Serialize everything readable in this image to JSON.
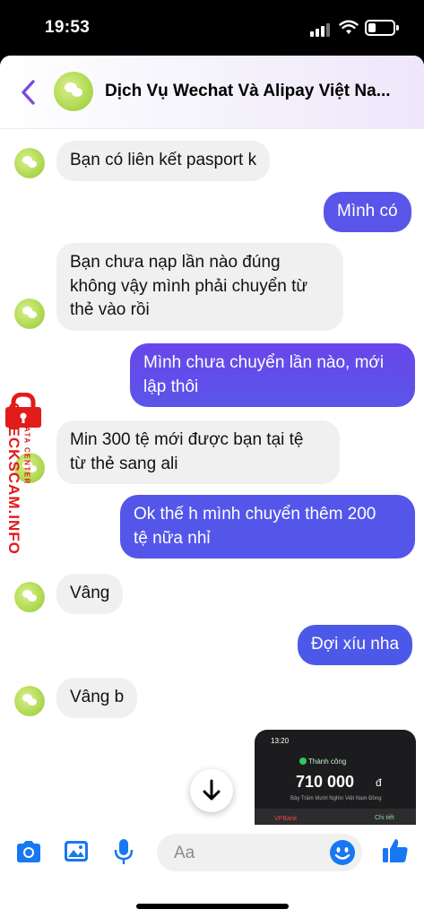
{
  "status_bar": {
    "time": "19:53"
  },
  "header": {
    "title": "Dịch Vụ Wechat Và Alipay Việt Na..."
  },
  "messages": [
    {
      "side": "in",
      "text": "Bạn có liên kết pasport k"
    },
    {
      "side": "out",
      "text": "Mình có"
    },
    {
      "side": "in",
      "text": "Bạn chưa nạp lần nào đúng\nkhông vậy mình phải chuyển từ\nthẻ vào rồi"
    },
    {
      "side": "out",
      "text": "Mình chưa chuyển lần nào, mới\nlập thôi"
    },
    {
      "side": "in",
      "text": "Min 300 tệ mới được bạn tại tệ\ntừ thẻ sang ali"
    },
    {
      "side": "out",
      "text": "Ok thế h mình chuyển thêm 200\ntệ nữa nhỉ"
    },
    {
      "side": "in",
      "text": "Vâng"
    },
    {
      "side": "out",
      "text": "Đợi xíu nha"
    },
    {
      "side": "in",
      "text": "Vâng b"
    }
  ],
  "screenshot_attachment": {
    "time": "13:20",
    "status": "Thành công",
    "amount": "710 000",
    "currency": "đ",
    "amount_words": "Bảy Trăm Mười Nghìn Việt Nam Đồng",
    "bank": "VPBank",
    "detail_link": "Chi tiết"
  },
  "composer": {
    "placeholder": "Aa"
  },
  "watermark": {
    "line1": "DATA CENTER",
    "line2": "CHECKSCAM.INFO"
  },
  "colors": {
    "accent": "#7b4be0",
    "bubble_out_start": "#8b3dea",
    "bubble_out_end": "#4d57e8",
    "icon_blue": "#1877f2"
  }
}
